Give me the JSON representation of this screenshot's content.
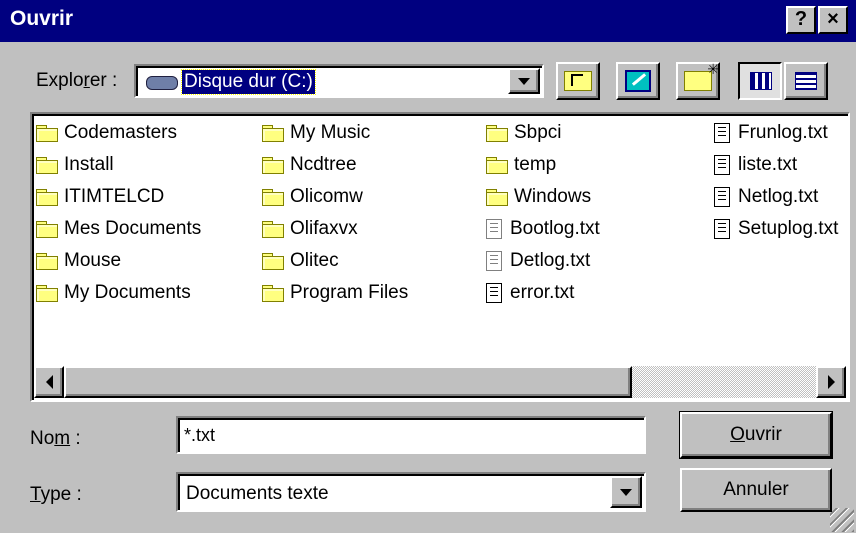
{
  "window": {
    "title": "Ouvrir",
    "help_label": "?",
    "close_label": "×"
  },
  "explorer": {
    "label_pre": "Explo",
    "label_ul": "r",
    "label_post": "er :",
    "selected": "Disque dur (C:)"
  },
  "files": {
    "columns": [
      [
        {
          "name": "Codemasters",
          "icon": "folder-icon"
        },
        {
          "name": "Install",
          "icon": "folder-icon"
        },
        {
          "name": "ITIMTELCD",
          "icon": "folder-icon"
        },
        {
          "name": "Mes Documents",
          "icon": "folder-icon"
        },
        {
          "name": "Mouse",
          "icon": "folder-icon"
        },
        {
          "name": "My Documents",
          "icon": "folder-icon"
        }
      ],
      [
        {
          "name": "My Music",
          "icon": "folder-icon"
        },
        {
          "name": "Ncdtree",
          "icon": "folder-icon"
        },
        {
          "name": "Olicomw",
          "icon": "folder-icon"
        },
        {
          "name": "Olifaxvx",
          "icon": "folder-icon"
        },
        {
          "name": "Olitec",
          "icon": "folder-icon"
        },
        {
          "name": "Program Files",
          "icon": "folder-icon"
        }
      ],
      [
        {
          "name": "Sbpci",
          "icon": "folder-icon"
        },
        {
          "name": "temp",
          "icon": "folder-icon"
        },
        {
          "name": "Windows",
          "icon": "folder-icon"
        },
        {
          "name": "Bootlog.txt",
          "icon": "text-file-icon-gray"
        },
        {
          "name": "Detlog.txt",
          "icon": "text-file-icon-gray"
        },
        {
          "name": "error.txt",
          "icon": "text-file-icon"
        }
      ],
      [
        {
          "name": "Frunlog.txt",
          "icon": "text-file-icon"
        },
        {
          "name": "liste.txt",
          "icon": "text-file-icon"
        },
        {
          "name": "Netlog.txt",
          "icon": "text-file-icon"
        },
        {
          "name": "Setuplog.txt",
          "icon": "text-file-icon"
        }
      ]
    ]
  },
  "form": {
    "name_label_pre": "No",
    "name_label_ul": "m",
    "name_label_post": " :",
    "name_value": "*.txt",
    "type_label_ul": "T",
    "type_label_post": "ype :",
    "type_value": "Documents texte"
  },
  "buttons": {
    "open_ul": "O",
    "open_rest": "uvrir",
    "cancel": "Annuler"
  },
  "colors": {
    "titlebar": "#000080",
    "face": "#c0c0c0",
    "selection": "#000080"
  }
}
